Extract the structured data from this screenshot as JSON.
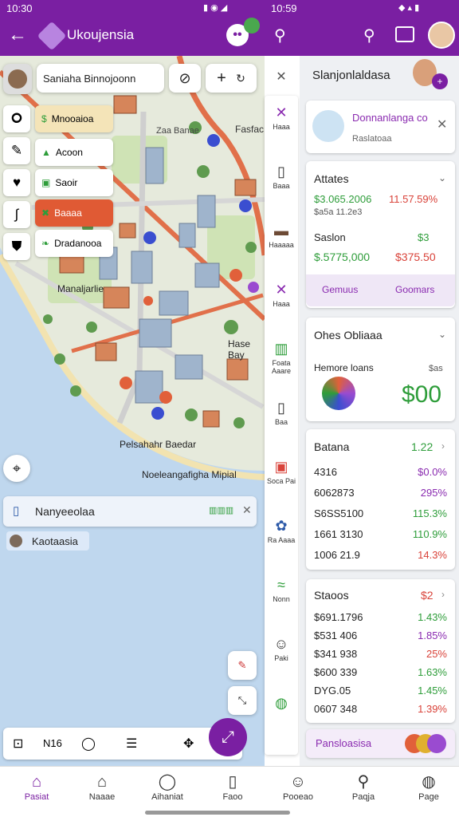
{
  "status": {
    "time_left": "10:30",
    "time_right": "10:59",
    "icons_left": "▮ ◉ ◢",
    "icons_right": "◆ ▴ ▮"
  },
  "appbar": {
    "title": "Ukoujensia",
    "back_icon": "arrow-left-icon",
    "search_icon": "search-icon"
  },
  "map": {
    "search_chip": "Saniaha Binnojoonn",
    "labels": {
      "top_right": "Fasfac",
      "area1": "Manaljarlie",
      "area2": "Hase Bay",
      "area3": "Pelsahahr Baedar",
      "area4": "Noeleangafigha Mipial",
      "small": "Zaa Banae"
    },
    "layers": [
      {
        "label": "Mnooaioa",
        "bg": "#f4e4b8",
        "icon": "$"
      },
      {
        "label": "Acoon",
        "bg": "#ffffff",
        "icon": "▲"
      },
      {
        "label": "Saoir",
        "bg": "#ffffff",
        "icon": "▣"
      },
      {
        "label": "Baaaa",
        "bg": "#e05a34",
        "icon": "✖"
      },
      {
        "label": "Dradanooa",
        "bg": "#ffffff",
        "icon": "❧"
      }
    ],
    "card_title": "Nanyeeolaa",
    "card_subtitle": "Kaotaasia",
    "card_badge": "▥▥▥"
  },
  "rail": [
    {
      "label": "Haaa",
      "icon": "✕"
    },
    {
      "label": "Baaa",
      "icon": "▯"
    },
    {
      "label": "Haaaaa",
      "icon": "▬"
    },
    {
      "label": "Haaa",
      "icon": "✕"
    },
    {
      "label": "Foata Aaare",
      "icon": "▥"
    },
    {
      "label": "Baa",
      "icon": "▯"
    },
    {
      "label": "Soca Pai",
      "icon": "▣"
    },
    {
      "label": "Ra Aaaa",
      "icon": "✿"
    },
    {
      "label": "Nonn",
      "icon": "≈"
    },
    {
      "label": "Paki",
      "icon": "☺"
    },
    {
      "label": "",
      "icon": "◍"
    }
  ],
  "side": {
    "title": "Slanjonlaldasa",
    "promo": {
      "title": "Donnanlanga co",
      "subtitle": "Raslatoaa"
    },
    "attates": {
      "title": "Attates",
      "val1": "$3.065.2006",
      "val2": "11.57.59%",
      "sub1": "$a5a 11.2e3",
      "name2": "Saslon",
      "val3": "$3",
      "val4": "$.5775,000",
      "val5": "$375.50",
      "btn1": "Gemuus",
      "btn2": "Goomars"
    },
    "ohes": {
      "title": "Ohes Obliaaa",
      "label": "Hemore loans",
      "small": "$as",
      "big": "$00"
    },
    "batana": {
      "title": "Batana",
      "head_val": "1.22",
      "rows": [
        {
          "name": "4316",
          "val": "$0.0%",
          "color": "#8a2bb0"
        },
        {
          "name": "6062873",
          "val": "295%",
          "color": "#8a2bb0"
        },
        {
          "name": "S6SS5100",
          "val": "115.3%",
          "color": "#2e9d3a"
        },
        {
          "name": "1661 3130",
          "val": "110.9%",
          "color": "#2e9d3a"
        },
        {
          "name": "1006 21.9",
          "val": "14.3%",
          "color": "#d9433a"
        }
      ]
    },
    "staoos": {
      "title": "Staoos",
      "head_val": "$2",
      "rows": [
        {
          "name": "$691.1796",
          "val": "1.43%",
          "color": "#2e9d3a"
        },
        {
          "name": "$531 406",
          "val": "1.85%",
          "color": "#8a2bb0"
        },
        {
          "name": "$341 938",
          "val": "25%",
          "color": "#d9433a"
        },
        {
          "name": "$600 339",
          "val": "1.63%",
          "color": "#2e9d3a"
        },
        {
          "name": "DYG.05",
          "val": "1.45%",
          "color": "#2e9d3a"
        },
        {
          "name": "0607 348",
          "val": "1.39%",
          "color": "#d9433a"
        }
      ]
    },
    "footer": "Pansloasisa"
  },
  "nav": [
    {
      "label": "Pasiat",
      "icon": "⌂",
      "active": true
    },
    {
      "label": "Naaae",
      "icon": "⌂"
    },
    {
      "label": "Aihaniat",
      "icon": "◯"
    },
    {
      "label": "Faoo",
      "icon": "▯"
    },
    {
      "label": "Pooeao",
      "icon": "☺"
    },
    {
      "label": "Paqja",
      "icon": "⚲"
    },
    {
      "label": "Page",
      "icon": "◍"
    }
  ],
  "toolbar": {
    "label": "N16"
  },
  "colors": {
    "brand": "#7a1fa2",
    "water": "#bfd7ee",
    "road": "#e1704a",
    "green": "#2e9d3a"
  }
}
